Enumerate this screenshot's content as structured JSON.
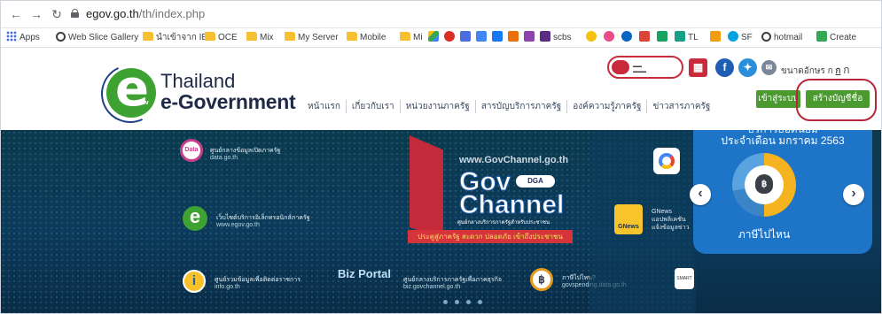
{
  "browser": {
    "url_domain": "egov.go.th",
    "url_path": "/th/index.php",
    "back_icon": "arrow-left-icon",
    "forward_icon": "arrow-right-icon",
    "reload_icon": "reload-icon"
  },
  "bookmarks": [
    {
      "label": "Apps",
      "icon": "apps-grid"
    },
    {
      "label": "Web Slice Gallery",
      "icon": "globe"
    },
    {
      "label": "นำเข้าจาก IE",
      "icon": "folder"
    },
    {
      "label": "OCE",
      "icon": "folder"
    },
    {
      "label": "Mix",
      "icon": "folder"
    },
    {
      "label": "My Server",
      "icon": "folder"
    },
    {
      "label": "Mobile",
      "icon": "folder"
    },
    {
      "label": "Mi",
      "icon": "folder"
    },
    {
      "label": "scbs",
      "icon": "bookmark"
    },
    {
      "label": "TL",
      "icon": "bookmark"
    },
    {
      "label": "SF",
      "icon": "bookmark"
    },
    {
      "label": "hotmail",
      "icon": "globe"
    },
    {
      "label": "Create",
      "icon": "bookmark"
    }
  ],
  "header": {
    "logo_line1": "Thailand",
    "logo_line2": "e-Government",
    "logo_gov": "Gov",
    "menu": [
      "หน้าแรก",
      "เกี่ยวกับเรา",
      "หน่วยงานภาครัฐ",
      "สารบัญบริการภาครัฐ",
      "องค์ความรู้ภาครัฐ",
      "ข่าวสารภาครัฐ"
    ],
    "login_label": "เข้าสู่ระบบ",
    "register_label": "สร้างบัญชีชื่อ",
    "font_size_label": "ขนาดอักษร ก",
    "font_size_a": "ก",
    "font_size_b": "ก"
  },
  "banner": {
    "services": [
      {
        "title": "ศูนย์กลางข้อมูลเปิดภาครัฐ",
        "sub": "data.go.th",
        "logo": "Data"
      },
      {
        "title": "เว็บไซต์บริการอิเล็กทรอนิกส์ภาครัฐ",
        "sub": "www.egov.go.th",
        "logo": "Gov"
      },
      {
        "title": "ศูนย์รวมข้อมูลเพื่อติดต่อราชการ",
        "sub": "info.go.th",
        "logo": "i"
      },
      {
        "title": "ศูนย์กลางบริการภาครัฐเพื่อภาคธุรกิจ",
        "sub": "biz.govchannel.go.th",
        "logo": "Biz Portal"
      },
      {
        "title": "ภาษีไปไหน?",
        "sub": "govspending.data.go.th",
        "logo": "฿"
      }
    ],
    "channel_url": "www.GovChannel.go.th",
    "channel_gov": "Gov",
    "channel_channel": "Channel",
    "channel_dga": "DGA",
    "channel_desc": "ศูนย์กลางบริการภาครัฐสำหรับประชาชน",
    "channel_tag": "ประตูสู่ภาครัฐ สะดวก ปลอดภัย เข้าถึงประชาชน",
    "gnews_title": "GNews",
    "gnews_sub1": "แอปพลิเคชัน",
    "gnews_sub2": "แจ้งข้อมูลข่าว",
    "panel_title_top": "บริการยอดนิยม",
    "panel_title": "ประจำเดือน มกราคม 2563",
    "panel_caption": "ภาษีไปไหน",
    "panel_donut_symbol": "฿"
  }
}
